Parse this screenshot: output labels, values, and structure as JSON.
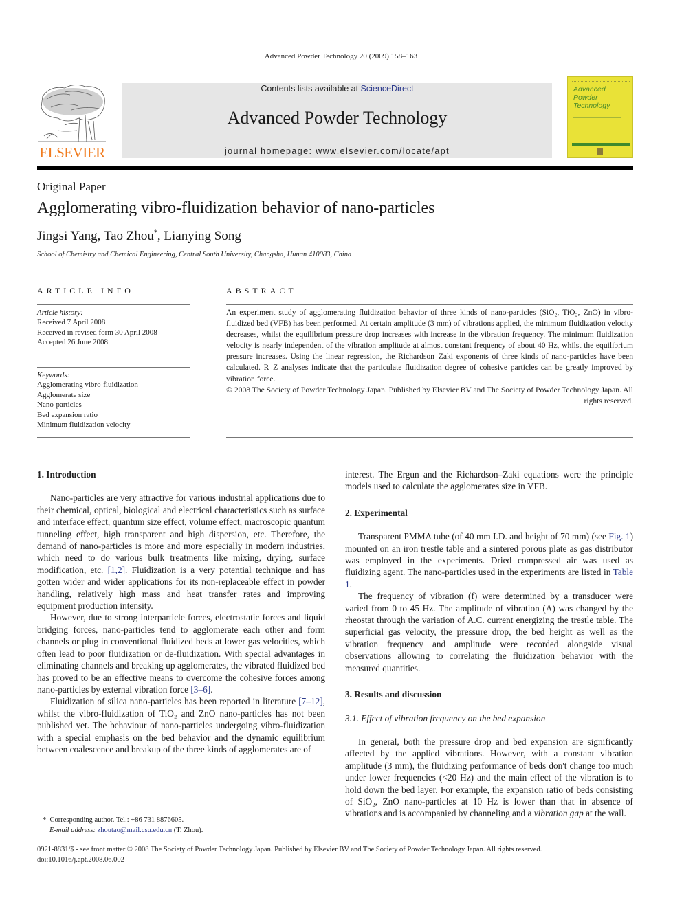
{
  "header": {
    "running_head": "Advanced Powder Technology 20 (2009) 158–163",
    "contents_prefix": "Contents lists available at ",
    "contents_link": "ScienceDirect",
    "journal_title": "Advanced Powder Technology",
    "homepage": "journal homepage: www.elsevier.com/locate/apt",
    "publisher_wordmark": "ELSEVIER",
    "cover_title_lines": [
      "Advanced",
      "Powder",
      "Technology"
    ],
    "colors": {
      "elsevier_orange": "#f07b1e",
      "link_blue": "#2c3a8c",
      "cover_yellow": "#e9e237",
      "cover_green": "#3f8a2c",
      "banner_gray": "#e6e6e6"
    }
  },
  "article": {
    "type": "Original Paper",
    "title": "Agglomerating vibro-fluidization behavior of nano-particles",
    "authors": [
      {
        "name": "Jingsi Yang",
        "sep": ", "
      },
      {
        "name": "Tao Zhou",
        "mark": "*",
        "sep": ", "
      },
      {
        "name": "Lianying Song",
        "sep": ""
      }
    ],
    "affiliation": "School of Chemistry and Chemical Engineering, Central South University, Changsha, Hunan 410083, China"
  },
  "article_info": {
    "heading": "ARTICLE INFO",
    "history_label": "Article history:",
    "history": [
      "Received 7 April 2008",
      "Received in revised form 30 April 2008",
      "Accepted 26 June 2008"
    ],
    "keywords_label": "Keywords:",
    "keywords": [
      "Agglomerating vibro-fluidization",
      "Agglomerate size",
      "Nano-particles",
      "Bed expansion ratio",
      "Minimum fluidization velocity"
    ]
  },
  "abstract": {
    "heading": "ABSTRACT",
    "text": "An experiment study of agglomerating fluidization behavior of three kinds of nano-particles (SiO₂, TiO₂, ZnO) in vibro-fluidized bed (VFB) has been performed. At certain amplitude (3 mm) of vibrations applied, the minimum fluidization velocity decreases, whilst the equilibrium pressure drop increases with increase in the vibration frequency. The minimum fluidization velocity is nearly independent of the vibration amplitude at almost constant frequency of about 40 Hz, whilst the equilibrium pressure increases. Using the linear regression, the Richardson–Zaki exponents of three kinds of nano-particles have been calculated. R–Z analyses indicate that the particulate fluidization degree of cohesive particles can be greatly improved by vibration force.",
    "copyright": "© 2008 The Society of Powder Technology Japan. Published by Elsevier BV and The Society of Powder Technology Japan. All rights reserved."
  },
  "body": {
    "sec1_heading": "1. Introduction",
    "p1_a": "Nano-particles are very attractive for various industrial applications due to their chemical, optical, biological and electrical characteristics such as surface and interface effect, quantum size effect, volume effect, macroscopic quantum tunneling effect, high transparent and high dispersion, etc. Therefore, the demand of nano-particles is more and more especially in modern industries, which need to do various bulk treatments like mixing, drying, surface modification, etc. ",
    "p1_ref": "[1,2]",
    "p1_b": ". Fluidization is a very potential technique and has gotten wider and wider applications for its non-replaceable effect in powder handling, relatively high mass and heat transfer rates and improving equipment production intensity.",
    "p2_a": "However, due to strong interparticle forces, electrostatic forces and liquid bridging forces, nano-particles tend to agglomerate each other and form channels or plug in conventional fluidized beds at lower gas velocities, which often lead to poor fluidization or de-fluidization. With special advantages in eliminating channels and breaking up agglomerates, the vibrated fluidized bed has proved to be an effective means to overcome the cohesive forces among nano-particles by external vibration force ",
    "p2_ref": "[3–6]",
    "p2_b": ".",
    "p3_a": "Fluidization of silica nano-particles has been reported in literature ",
    "p3_ref": "[7–12]",
    "p3_b": ", whilst the vibro-fluidization of TiO₂ and ZnO nano-particles has not been published yet. The behaviour of nano-particles undergoing vibro-fluidization with a special emphasis on the bed behavior and the dynamic equilibrium between coalescence and breakup of the three kinds of agglomerates are of",
    "p3_cont": "interest. The Ergun and the Richardson–Zaki equations were the principle models used to calculate the agglomerates size in VFB.",
    "sec2_heading": "2. Experimental",
    "p4_a": "Transparent PMMA tube (of 40 mm I.D. and height of 70 mm) (see ",
    "p4_ref1": "Fig. 1",
    "p4_b": ") mounted on an iron trestle table and a sintered porous plate as gas distributor was employed in the experiments. Dried compressed air was used as fluidizing agent. The nano-particles used in the experiments are listed in ",
    "p4_ref2": "Table 1",
    "p4_c": ".",
    "p5": "The frequency of vibration (f) were determined by a transducer were varied from 0 to 45 Hz. The amplitude of vibration (A) was changed by the rheostat through the variation of A.C. current energizing the trestle table. The superficial gas velocity, the pressure drop, the bed height as well as the vibration frequency and amplitude were recorded alongside visual observations allowing to correlating the fluidization behavior with the measured quantities.",
    "sec3_heading": "3. Results and discussion",
    "sec31_heading": "3.1. Effect of vibration frequency on the bed expansion",
    "p6_a": "In general, both the pressure drop and bed expansion are significantly affected by the applied vibrations. However, with a constant vibration amplitude (3 mm), the fluidizing performance of beds don't change too much under lower frequencies (<20 Hz) and the main effect of the vibration is to hold down the bed layer. For example, the expansion ratio of beds consisting of SiO₂, ZnO nano-particles at 10 Hz is lower than that in absence of vibrations and is accompanied by channeling and a ",
    "p6_em": "vibration gap",
    "p6_b": " at the wall."
  },
  "footnote": {
    "mark": "*",
    "line1": "Corresponding author. Tel.: +86 731 8876605.",
    "email_label": "E-mail address: ",
    "email": "zhoutao@mail.csu.edu.cn",
    "email_suffix": " (T. Zhou)."
  },
  "bottom": {
    "issn_line": "0921-8831/$ - see front matter © 2008 The Society of Powder Technology Japan. Published by Elsevier BV and The Society of Powder Technology Japan. All rights reserved.",
    "doi": "doi:10.1016/j.apt.2008.06.002"
  }
}
